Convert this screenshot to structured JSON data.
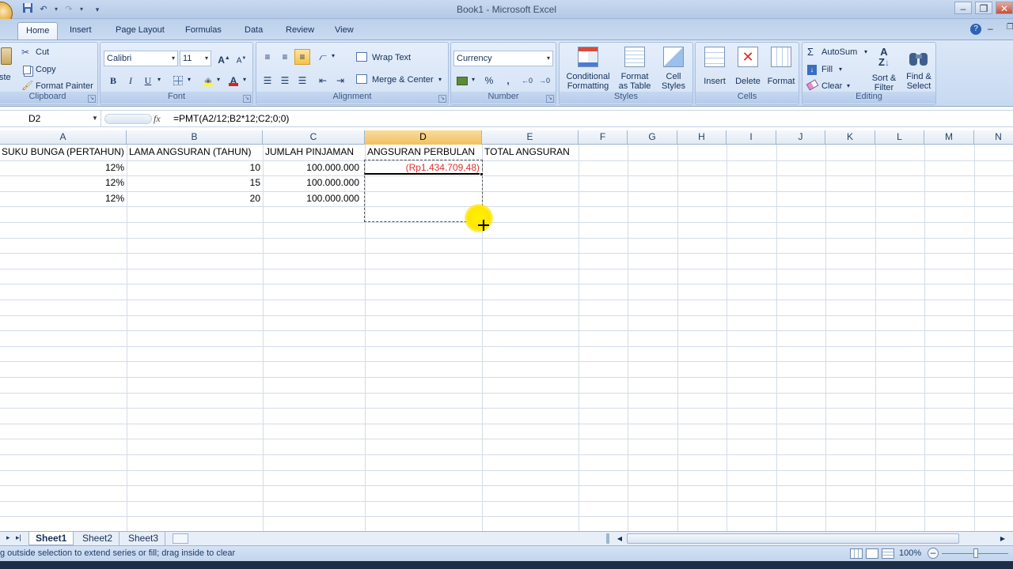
{
  "window": {
    "title": "Book1 - Microsoft Excel"
  },
  "tabs": [
    "Home",
    "Insert",
    "Page Layout",
    "Formulas",
    "Data",
    "Review",
    "View"
  ],
  "active_tab": "Home",
  "ribbon": {
    "clipboard": {
      "label": "Clipboard",
      "paste_partial": "ste",
      "cut": "Cut",
      "copy": "Copy",
      "format_painter": "Format Painter"
    },
    "font": {
      "label": "Font",
      "name": "Calibri",
      "size": "11",
      "bold": "B",
      "italic": "I",
      "underline": "U",
      "grow": "A",
      "shrink": "A",
      "font_color": "A"
    },
    "alignment": {
      "label": "Alignment",
      "wrap_text": "Wrap Text",
      "merge_center": "Merge & Center"
    },
    "number": {
      "label": "Number",
      "format": "Currency",
      "percent": "%",
      "comma": ","
    },
    "styles": {
      "label": "Styles",
      "conditional_formatting_1": "Conditional",
      "conditional_formatting_2": "Formatting",
      "format_as_table_1": "Format",
      "format_as_table_2": "as Table",
      "cell_styles_1": "Cell",
      "cell_styles_2": "Styles"
    },
    "cells": {
      "label": "Cells",
      "insert": "Insert",
      "delete": "Delete",
      "format": "Format"
    },
    "editing": {
      "label": "Editing",
      "autosum": "AutoSum",
      "fill": "Fill",
      "clear": "Clear",
      "sort_filter_1": "Sort &",
      "sort_filter_2": "Filter",
      "find_select_1": "Find &",
      "find_select_2": "Select"
    }
  },
  "formula_bar": {
    "name_box": "D2",
    "fx": "fx",
    "formula": "=PMT(A2/12;B2*12;C2;0;0)"
  },
  "columns": [
    "A",
    "B",
    "C",
    "D",
    "E",
    "F",
    "G",
    "H",
    "I",
    "J",
    "K",
    "L",
    "M",
    "N"
  ],
  "selected_column": "D",
  "rows": [
    {
      "A": "SUKU BUNGA (PERTAHUN)",
      "B": "LAMA ANGSURAN (TAHUN)",
      "C": "JUMLAH PINJAMAN",
      "D": "ANGSURAN PERBULAN",
      "E": "TOTAL ANGSURAN"
    },
    {
      "A": "12%",
      "B": "10",
      "C": "100.000.000",
      "D": "(Rp1.434.709,48)",
      "E": ""
    },
    {
      "A": "12%",
      "B": "15",
      "C": "100.000.000",
      "D": "",
      "E": ""
    },
    {
      "A": "12%",
      "B": "20",
      "C": "100.000.000",
      "D": "",
      "E": ""
    }
  ],
  "colors": {
    "negative_value": "#e03030",
    "selected_header": "#f1c15f",
    "cursor_highlight": "#ffe600"
  },
  "sheets": [
    "Sheet1",
    "Sheet2",
    "Sheet3"
  ],
  "active_sheet": "Sheet1",
  "status": {
    "message": "g outside selection to extend series or fill; drag inside to clear",
    "zoom": "100%"
  }
}
